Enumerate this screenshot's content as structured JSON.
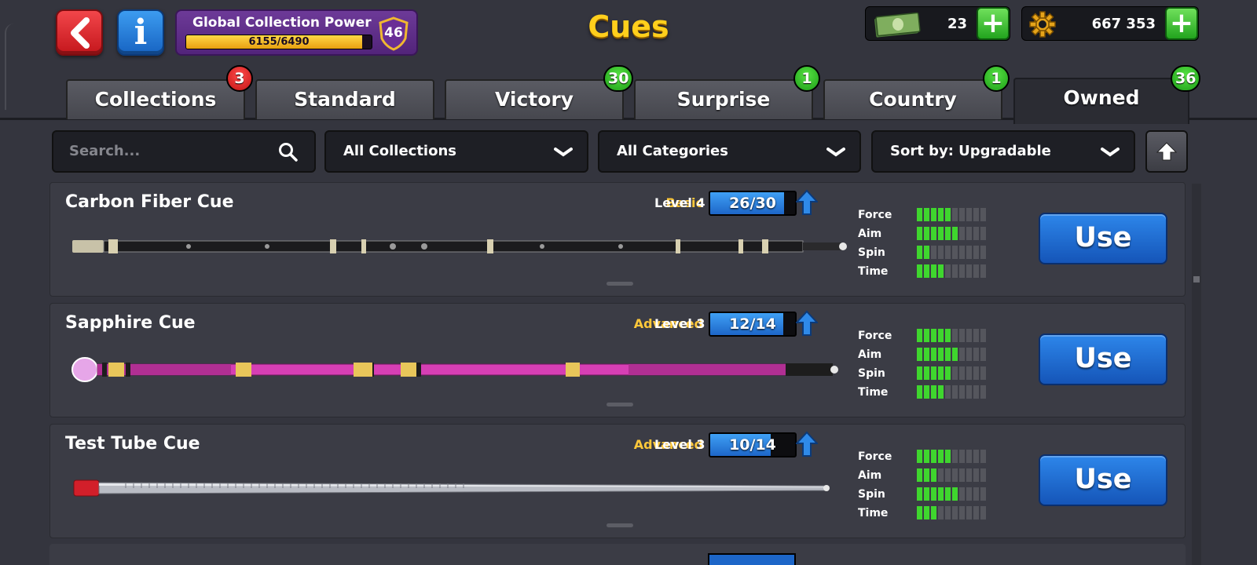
{
  "header": {
    "title": "Cues",
    "collection_power": {
      "label": "Global Collection Power",
      "progress_text": "6155/6490",
      "progress_fraction": 0.948,
      "level": "46"
    },
    "cash": {
      "value": "23"
    },
    "coins": {
      "value": "667 353"
    }
  },
  "tabs": [
    {
      "label": "Collections",
      "badge": "3",
      "badge_color": "red"
    },
    {
      "label": "Standard",
      "badge": ""
    },
    {
      "label": "Victory",
      "badge": "30",
      "badge_color": "green"
    },
    {
      "label": "Surprise",
      "badge": "1",
      "badge_color": "green"
    },
    {
      "label": "Country",
      "badge": "1",
      "badge_color": "green"
    },
    {
      "label": "Owned",
      "badge": "36",
      "badge_color": "green",
      "active": true
    }
  ],
  "filters": {
    "search_placeholder": "Search...",
    "collections": "All Collections",
    "categories": "All Categories",
    "sort": "Sort by: Upgradable"
  },
  "stat_labels": [
    "Force",
    "Aim",
    "Spin",
    "Time"
  ],
  "cues": [
    {
      "name": "Carbon Fiber Cue",
      "rarity": "Basic",
      "level": "Level 4",
      "progress_text": "26/30",
      "progress_fraction": 0.867,
      "stats": [
        5,
        6,
        2,
        4
      ],
      "button": "Use"
    },
    {
      "name": "Sapphire Cue",
      "rarity": "Advanced",
      "level": "Level 3",
      "progress_text": "12/14",
      "progress_fraction": 0.857,
      "stats": [
        5,
        6,
        5,
        4
      ],
      "button": "Use"
    },
    {
      "name": "Test Tube Cue",
      "rarity": "Advanced",
      "level": "Level 3",
      "progress_text": "10/14",
      "progress_fraction": 0.714,
      "stats": [
        5,
        3,
        6,
        3
      ],
      "button": "Use"
    }
  ],
  "colors": {
    "accent_gold": "#ffcf1c",
    "rarity_text": "#ffc83a",
    "stat_on": "#3fd62e",
    "use_button": "#1d66c8"
  }
}
